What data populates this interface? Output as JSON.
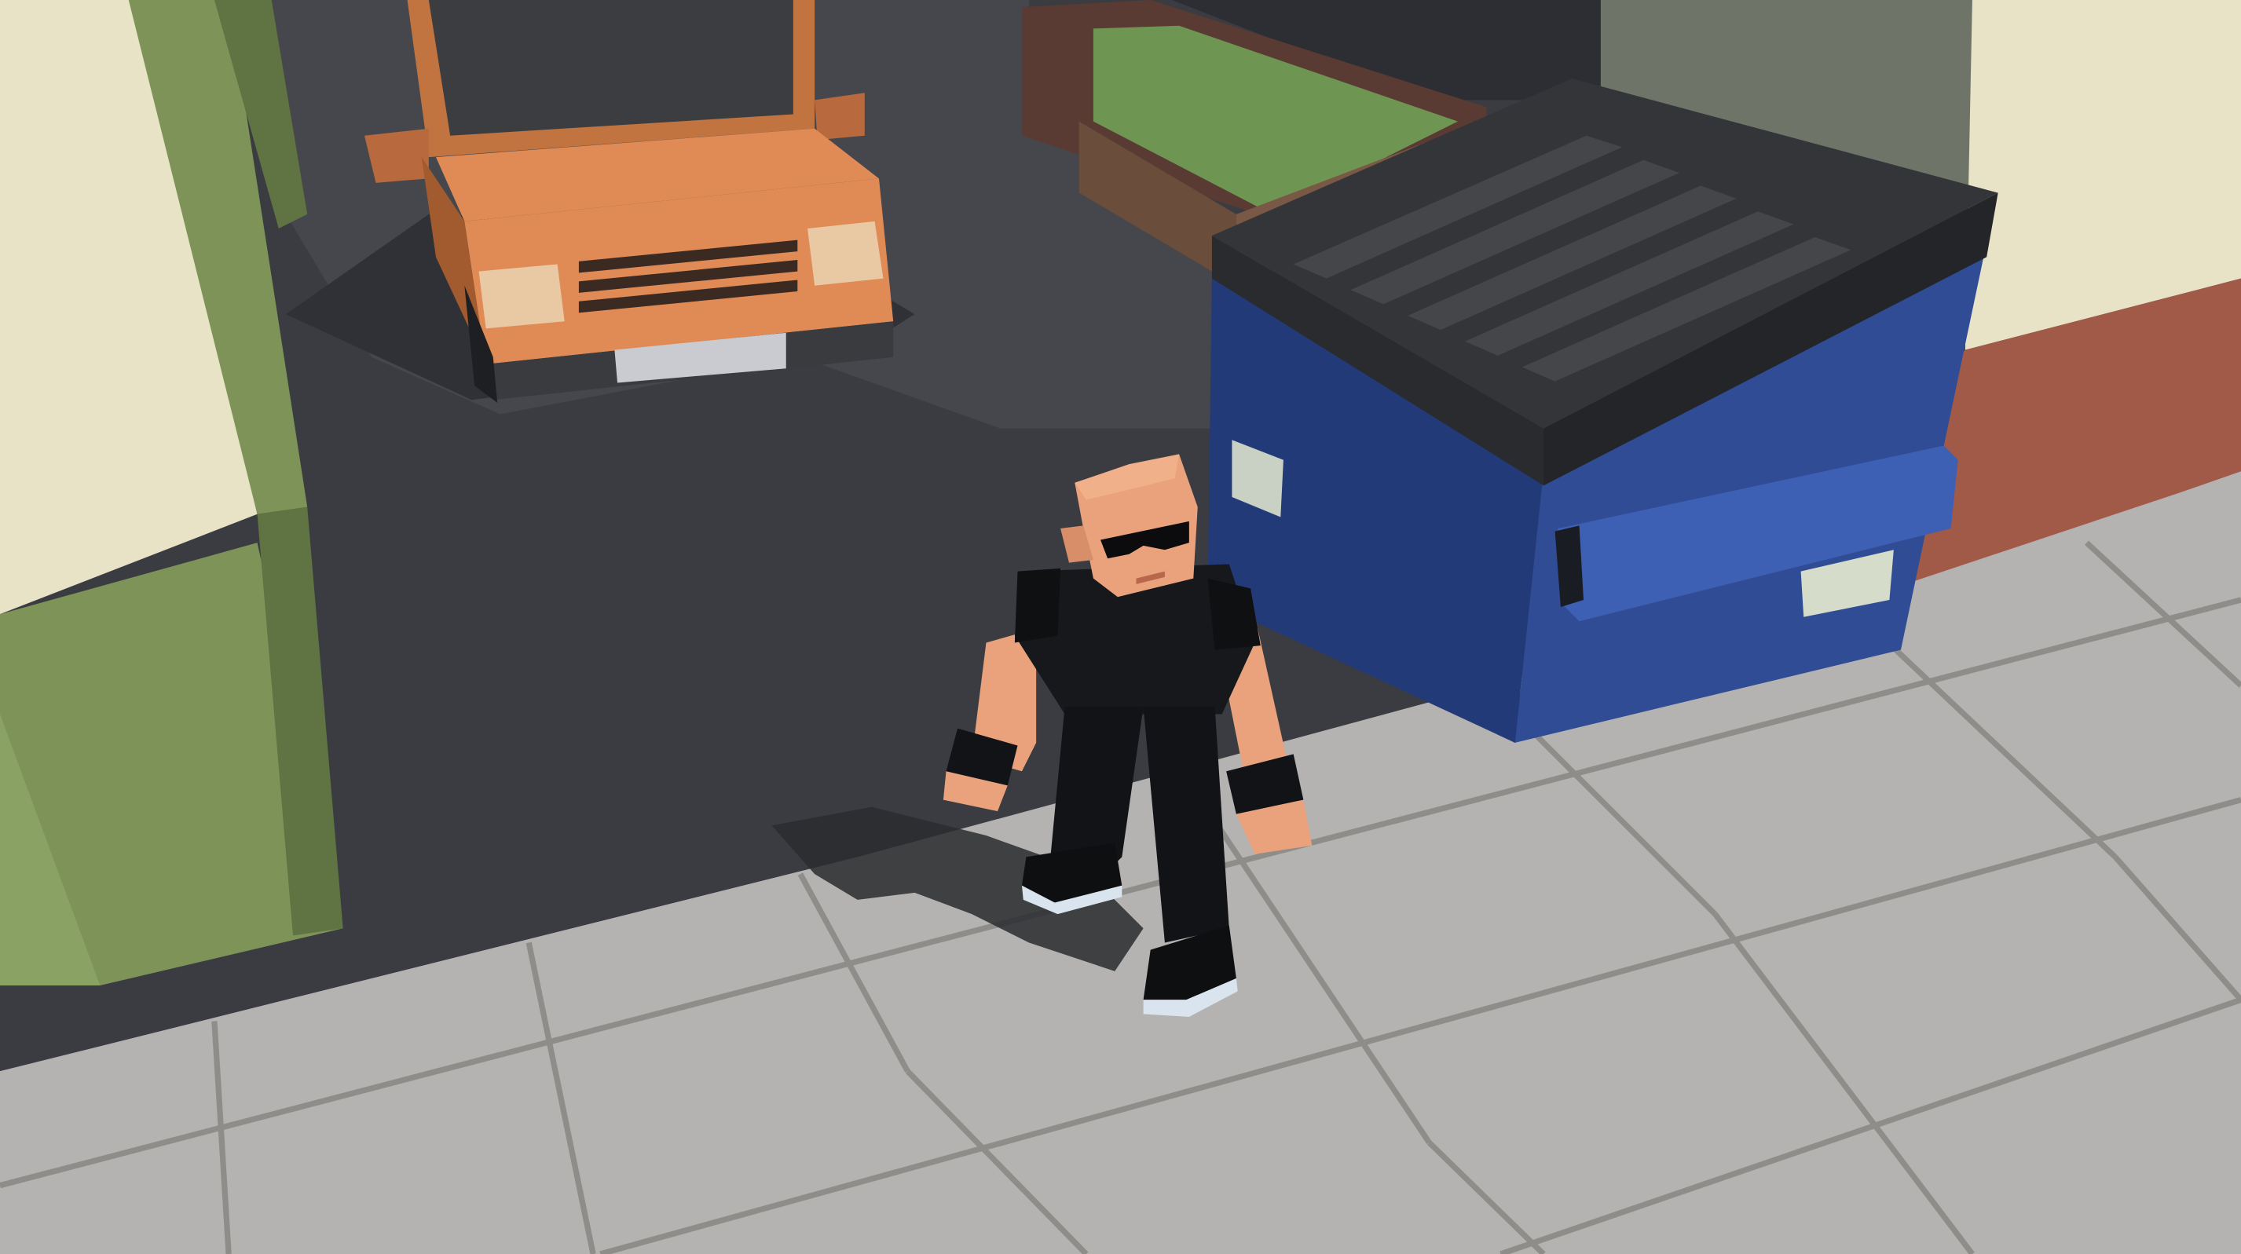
{
  "scene": {
    "palette": {
      "sky_shadow": "#2c2e33",
      "asphalt": "#3b3c41",
      "asphalt_shadow": "#303136",
      "sidewalk": "#b4b3b1",
      "sidewalk_joint": "#8f8d8a",
      "building_cream": "#e8e3c6",
      "building_green": "#7e9358",
      "building_green_dark": "#5f7343",
      "brick_red": "#a15a47",
      "truck_orange": "#e08a55",
      "truck_orange_dark": "#b8693d",
      "truck_light": "#e8c9a3",
      "dumpster_blue": "#2f4c95",
      "dumpster_blue_dark": "#233a78",
      "dumpster_lid": "#343538",
      "dumpster_lid_slot": "#45464a",
      "planter_green": "#6f9553",
      "planter_brown": "#6b4d3b",
      "character_skin": "#e9a27b",
      "character_outfit": "#121316",
      "character_sole": "#d9e4ee"
    },
    "objects": [
      "truck",
      "dumpster",
      "character",
      "building-left",
      "building-right",
      "planter",
      "sidewalk"
    ]
  }
}
